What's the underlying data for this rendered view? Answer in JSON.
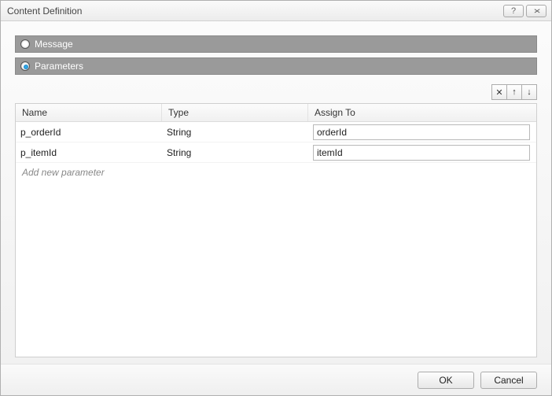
{
  "window": {
    "title": "Content Definition"
  },
  "options": {
    "message_label": "Message",
    "parameters_label": "Parameters",
    "selected": "parameters"
  },
  "table": {
    "headers": {
      "name": "Name",
      "type": "Type",
      "assign": "Assign To"
    },
    "rows": [
      {
        "name": "p_orderId",
        "type": "String",
        "assign": "orderId"
      },
      {
        "name": "p_itemId",
        "type": "String",
        "assign": "itemId"
      }
    ],
    "add_placeholder": "Add new parameter"
  },
  "toolbar": {
    "delete_glyph": "✕",
    "up_glyph": "↑",
    "down_glyph": "↓"
  },
  "buttons": {
    "ok": "OK",
    "cancel": "Cancel"
  }
}
